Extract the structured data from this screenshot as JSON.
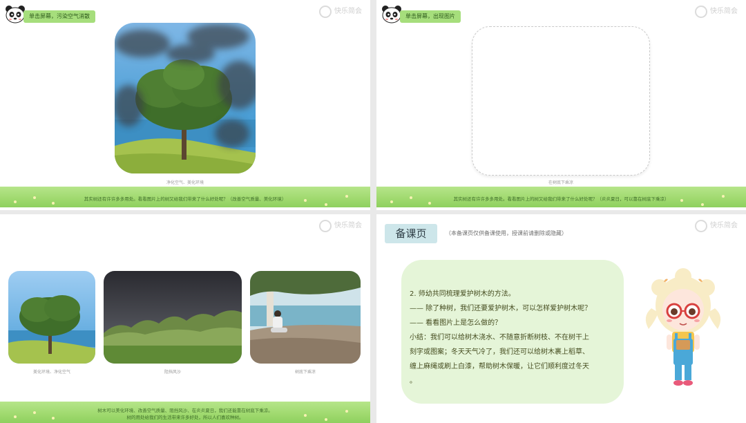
{
  "watermark": {
    "label": "快乐简会"
  },
  "slide1": {
    "tag": "单击屏幕，污染空气消散",
    "caption": "净化空气、美化环境",
    "band_text": "其实树还有许许多多用处。看看图片上的树又给我们带来了什么好处呢？（改善空气质量、美化环境）"
  },
  "slide2": {
    "tag": "单击屏幕，出现图片",
    "caption": "在树底下乘凉",
    "band_text": "其实树还有许许多多用处。看看图片上的树又给我们带来了什么好处呢？（炎炎夏日，可以靠在树底下乘凉）"
  },
  "slide3": {
    "captions": [
      "美化环境、净化空气",
      "阻挡风沙",
      "树底下乘凉"
    ],
    "band_text_1": "树木可以美化环境、改善空气质量、阻挡风沙、在炎炎夏日，我们还能靠在树底下乘凉。",
    "band_text_2": "树的用处给我们的生活带来许多好处，所以人们喜欢种树。"
  },
  "slide4": {
    "title": "备课页",
    "note": "（本备课页仅供备课使用，授课前请删除或隐藏）",
    "lines": [
      "2. 师幼共同梳理爱护树木的方法。",
      "—— 除了种树，我们还要爱护树木，可以怎样爱护树木呢？",
      "—— 看看图片上是怎么做的？",
      "小结：我们可以给树木浇水、不随意折断树枝、不在树干上",
      "刻字或图案；冬天天气冷了，我们还可以给树木裹上稻草、",
      "缠上麻绳或刷上白漆，帮助树木保暖，让它们顺利度过冬天",
      "。"
    ]
  },
  "colors": {
    "tag_bg": "#a6de7c",
    "grass": "#9fd96e",
    "bubble": "#e5f5d8",
    "prep_title_bg": "#cde6ea"
  }
}
